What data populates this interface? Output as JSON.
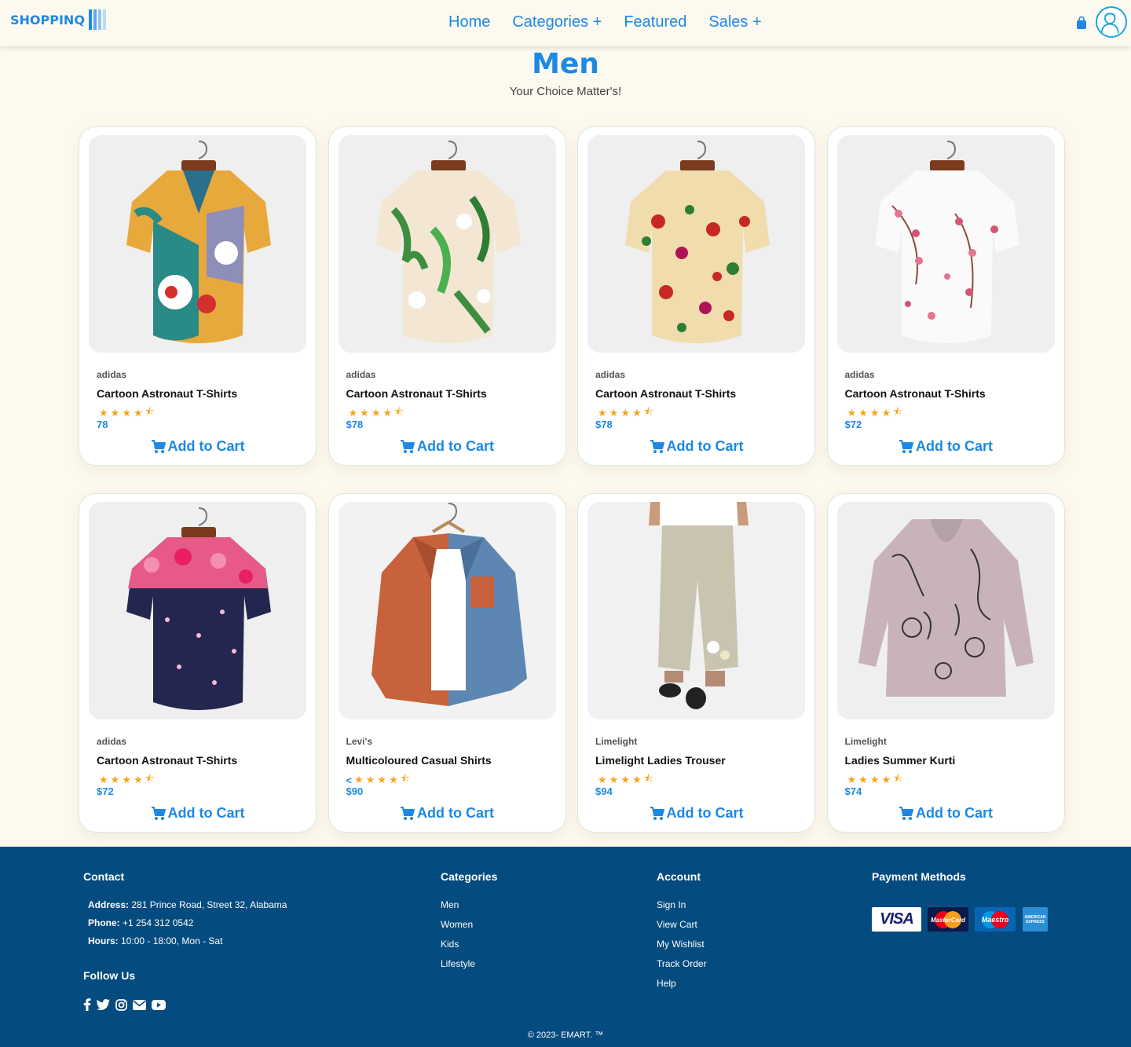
{
  "brand": {
    "logo_text": "SHOPPINQ"
  },
  "nav": {
    "links": [
      "Home",
      "Categories +",
      "Featured",
      "Sales +"
    ]
  },
  "header": {
    "title": "Men",
    "subtitle": "Your Choice Matter's!"
  },
  "products": [
    {
      "brand": "adidas",
      "name": "Cartoon Astronaut T-Shirts",
      "rating_prefix": "",
      "price": "78",
      "rating": 4.5,
      "cta": "Add to Cart"
    },
    {
      "brand": "adidas",
      "name": "Cartoon Astronaut T-Shirts",
      "rating_prefix": "",
      "price": "$78",
      "rating": 4.5,
      "cta": "Add to Cart"
    },
    {
      "brand": "adidas",
      "name": "Cartoon Astronaut T-Shirts",
      "rating_prefix": "",
      "price": "$78",
      "rating": 4.5,
      "cta": "Add to Cart"
    },
    {
      "brand": "adidas",
      "name": "Cartoon Astronaut T-Shirts",
      "rating_prefix": "",
      "price": "$72",
      "rating": 4.5,
      "cta": "Add to Cart"
    },
    {
      "brand": "adidas",
      "name": "Cartoon Astronaut T-Shirts",
      "rating_prefix": "",
      "price": "$72",
      "rating": 4.5,
      "cta": "Add to Cart"
    },
    {
      "brand": "Levi's",
      "name": "Multicoloured Casual Shirts",
      "rating_prefix": "<",
      "price": "$90",
      "rating": 4.5,
      "cta": "Add to Cart"
    },
    {
      "brand": "Limelight",
      "name": "Limelight Ladies Trouser",
      "rating_prefix": "",
      "price": "$94",
      "rating": 4.5,
      "cta": "Add to Cart"
    },
    {
      "brand": "Limelight",
      "name": "Ladies Summer Kurti",
      "rating_prefix": "",
      "price": "$74",
      "rating": 4.5,
      "cta": "Add to Cart"
    }
  ],
  "footer": {
    "contact": {
      "heading": "Contact",
      "address_label": "Address:",
      "address": " 281 Prince Road, Street 32, Alabama",
      "phone_label": "Phone:",
      "phone": " +1 254 312 0542",
      "hours_label": "Hours:",
      "hours": " 10:00 - 18:00, Mon - Sat"
    },
    "follow_heading": "Follow Us",
    "categories": {
      "heading": "Categories",
      "items": [
        "Men",
        "Women",
        "Kids",
        "Lifestyle"
      ]
    },
    "account": {
      "heading": "Account",
      "items": [
        "Sign In",
        "View Cart",
        "My Wishlist",
        "Track Order",
        "Help"
      ]
    },
    "payment": {
      "heading": "Payment Methods",
      "cards": [
        "VISA",
        "MasterCard",
        "Maestro",
        "AMERICAN EXPRESS"
      ]
    },
    "copyright": "© 2023- EMART. ™"
  },
  "colors": {
    "accent": "#1e88e5",
    "footer_bg": "#044b7f",
    "star": "#f4a51c",
    "page_bg": "#fdf9ee"
  },
  "icons": [
    "cart-icon",
    "user-avatar-icon",
    "shopping-cart-icon",
    "star-icon",
    "star-half-icon",
    "facebook-icon",
    "twitter-icon",
    "instagram-icon",
    "envelope-icon",
    "youtube-icon"
  ]
}
